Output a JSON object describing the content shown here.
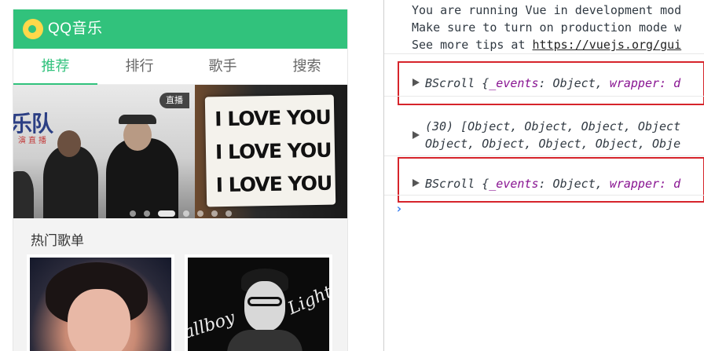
{
  "app": {
    "title": "QQ音乐",
    "brand_color": "#31c27c",
    "tabs": [
      {
        "label": "推荐",
        "active": true
      },
      {
        "label": "排行",
        "active": false
      },
      {
        "label": "歌手",
        "active": false
      },
      {
        "label": "搜索",
        "active": false
      }
    ],
    "slider": {
      "badge": "直播",
      "band_text": "乐队",
      "band_sub": "演直播",
      "sign_lines": [
        "I LOVE YOU",
        "I LOVE YOU",
        "I LOVE YOU"
      ],
      "dot_count": 7,
      "active_dot": 3
    },
    "section_title": "热门歌单",
    "cards": [
      {
        "icon": "portrait-woman-image"
      },
      {
        "icon": "portrait-man-image",
        "script_left": "allboy",
        "script_right": "Lights"
      }
    ]
  },
  "console": {
    "info_lines": [
      "You are running Vue in development mod",
      "Make sure to turn on production mode w",
      "See more tips at "
    ],
    "info_link": "https://vuejs.org/gui",
    "logs": [
      {
        "prefix": "BScroll {",
        "k1": "_events",
        "v1": ": Object, ",
        "k2": "wrapper",
        "v2": ": d",
        "highlighted": true
      },
      {
        "line1": "(30) [Object, Object, Object, Object",
        "line2": "Object, Object, Object, Object, Obje",
        "highlighted": false
      },
      {
        "prefix": "BScroll {",
        "k1": "_events",
        "v1": ": Object, ",
        "k2": "wrapper",
        "v2": ": d",
        "highlighted": true
      }
    ],
    "prompt": "›",
    "highlight_color": "#d6242b",
    "key_color": "#881391",
    "prompt_color": "#367cf1"
  }
}
